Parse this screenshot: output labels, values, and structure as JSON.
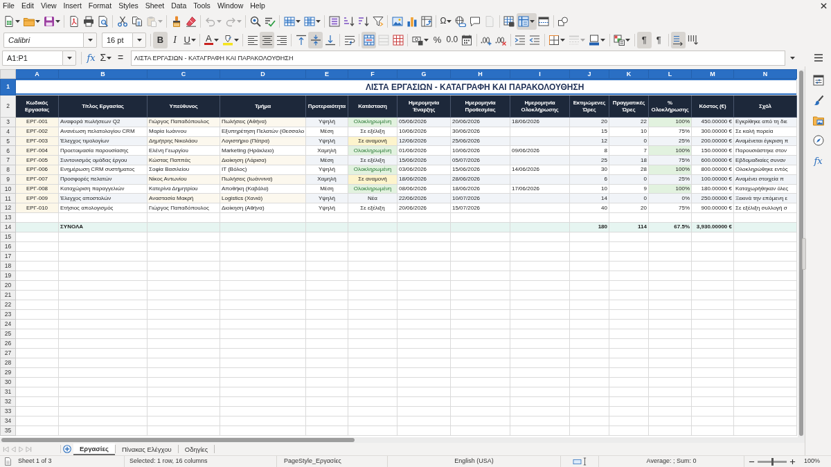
{
  "menu": [
    "File",
    "Edit",
    "View",
    "Insert",
    "Format",
    "Styles",
    "Sheet",
    "Data",
    "Tools",
    "Window",
    "Help"
  ],
  "standard_toolbar": [
    {
      "pressed": false,
      "disabled": false
    },
    {
      "pressed": false,
      "disabled": false
    },
    {
      "pressed": false,
      "disabled": false
    },
    {
      "pressed": false,
      "disabled": false
    },
    {
      "pressed": false,
      "disabled": false
    },
    {
      "pressed": false,
      "disabled": false
    },
    {
      "pressed": false,
      "disabled": false
    },
    {
      "pressed": false,
      "disabled": false
    },
    {
      "pressed": false,
      "disabled": true
    },
    {
      "pressed": false,
      "disabled": false
    },
    {
      "pressed": false,
      "disabled": false
    },
    {
      "pressed": false,
      "disabled": true
    },
    {
      "pressed": false,
      "disabled": true
    },
    {
      "pressed": false,
      "disabled": false
    },
    {
      "pressed": false,
      "disabled": false
    },
    {
      "pressed": false,
      "disabled": false
    },
    {
      "pressed": false,
      "disabled": false
    },
    {
      "pressed": false,
      "disabled": false
    },
    {
      "pressed": false,
      "disabled": false
    },
    {
      "pressed": false,
      "disabled": false
    },
    {
      "pressed": false,
      "disabled": false
    },
    {
      "pressed": false,
      "disabled": false
    },
    {
      "pressed": false,
      "disabled": false
    },
    {
      "pressed": false,
      "disabled": false
    },
    {
      "label": "Ω",
      "pressed": false,
      "disabled": false
    },
    {
      "pressed": false,
      "disabled": false
    },
    {
      "pressed": false,
      "disabled": false
    },
    {
      "pressed": false,
      "disabled": true
    },
    {
      "pressed": false,
      "disabled": false
    },
    {
      "pressed": true,
      "disabled": false
    },
    {
      "pressed": false,
      "disabled": false
    },
    {
      "pressed": false,
      "disabled": false
    }
  ],
  "formatting_toolbar": {
    "font_name": "Calibri",
    "font_size": "16 pt",
    "buttons": [
      {
        "label": "B",
        "pressed": true,
        "disabled": false
      },
      {
        "label": "I",
        "pressed": false,
        "disabled": false
      },
      {
        "label": "U",
        "pressed": false,
        "disabled": false
      },
      {
        "label": "A",
        "pressed": false,
        "disabled": false
      },
      {
        "pressed": false,
        "disabled": false
      },
      {
        "pressed": false,
        "disabled": false
      },
      {
        "pressed": true,
        "disabled": false
      },
      {
        "pressed": false,
        "disabled": false
      },
      {
        "pressed": false,
        "disabled": false
      },
      {
        "pressed": true,
        "disabled": false
      },
      {
        "pressed": false,
        "disabled": false
      },
      {
        "pressed": false,
        "disabled": false
      },
      {
        "pressed": true,
        "disabled": false
      },
      {
        "pressed": false,
        "disabled": true
      },
      {
        "pressed": false,
        "disabled": false
      },
      {
        "pressed": false,
        "disabled": false
      },
      {
        "label": "%",
        "pressed": false,
        "disabled": false
      },
      {
        "label": "0.0",
        "pressed": false,
        "disabled": false
      },
      {
        "pressed": false,
        "disabled": false
      },
      {
        "pressed": false,
        "disabled": false
      },
      {
        "pressed": false,
        "disabled": false
      },
      {
        "pressed": false,
        "disabled": false
      },
      {
        "pressed": false,
        "disabled": false
      },
      {
        "pressed": false,
        "disabled": false
      },
      {
        "pressed": false,
        "disabled": true
      },
      {
        "pressed": false,
        "disabled": false
      },
      {
        "pressed": false,
        "disabled": false
      },
      {
        "label": "¶",
        "pressed": true,
        "disabled": false
      },
      {
        "label": "¶",
        "pressed": false,
        "disabled": false
      },
      {
        "pressed": true,
        "disabled": false
      },
      {
        "pressed": false,
        "disabled": false
      }
    ]
  },
  "formula_bar": {
    "name_box": "A1:P1",
    "function_wizard": "fx",
    "sum": "Σ",
    "equals": "=",
    "content": "ΛΙΣΤΑ ΕΡΓΑΣΙΩΝ - ΚΑΤΑΓΡΑΦΗ ΚΑΙ ΠΑΡΑΚΟΛΟΥΘΗΣΗ"
  },
  "sheet": {
    "columns": [
      {
        "letter": "A",
        "selected": true
      },
      {
        "letter": "B",
        "selected": true
      },
      {
        "letter": "C",
        "selected": true
      },
      {
        "letter": "D",
        "selected": true
      },
      {
        "letter": "E",
        "selected": true
      },
      {
        "letter": "F",
        "selected": true
      },
      {
        "letter": "G",
        "selected": true
      },
      {
        "letter": "H",
        "selected": true
      },
      {
        "letter": "I",
        "selected": true
      },
      {
        "letter": "J",
        "selected": true
      },
      {
        "letter": "K",
        "selected": true
      },
      {
        "letter": "L",
        "selected": true
      },
      {
        "letter": "M",
        "selected": true
      },
      {
        "letter": "N",
        "selected": true
      }
    ],
    "rows": [
      {
        "number": "1",
        "kind": "title",
        "selected": true,
        "text": "ΛΙΣΤΑ ΕΡΓΑΣΙΩΝ - ΚΑΤΑΓΡΑΦΗ ΚΑΙ ΠΑΡΑΚΟΛΟΥΘΗΣΗ"
      },
      {
        "number": "2",
        "kind": "header",
        "selected": false,
        "cells": {
          "A": "Κωδικός Εργασίας",
          "B": "Τίτλος Εργασίας",
          "C": "Υπεύθυνος",
          "D": "Τμήμα",
          "E": "Προτεραιότητα",
          "F": "Κατάσταση",
          "G": "Ημερομηνία Έναρξης",
          "H": "Ημερομηνία Προθεσμίας",
          "I": "Ημερομηνία Ολοκλήρωσης",
          "J": "Εκτιμώμενες Ώρες",
          "K": "Πραγματικές Ώρες",
          "L": "% Ολοκλήρωσης",
          "M": "Κόστος (€)",
          "N": "Σχόλ"
        }
      },
      {
        "number": "3",
        "kind": "data",
        "selected": false,
        "complete": true,
        "waiting": false,
        "department_clipped": false,
        "cells": {
          "A": "ΕΡΓ-001",
          "B": "Αναφορά πωλήσεων Q2",
          "C": "Γιώργος Παπαδόπουλος",
          "D": "Πωλήσεις (Αθήνα)",
          "E": "Υψηλή",
          "F": "Ολοκληρωμένη",
          "G": "05/06/2026",
          "H": "20/06/2026",
          "I": "18/06/2026",
          "J": "20",
          "K": "22",
          "L": "100%",
          "M": "450.00000 €",
          "N": "Εγκρίθηκε από τη διε"
        }
      },
      {
        "number": "4",
        "kind": "data",
        "selected": false,
        "complete": false,
        "waiting": false,
        "department_clipped": true,
        "cells": {
          "A": "ΕΡΓ-002",
          "B": "Ανανέωση πελατολογίου CRM",
          "C": "Μαρία Ιωάννου",
          "D": "Εξυπηρέτηση Πελατών (Θεσσαλο",
          "E": "Μέση",
          "F": "Σε εξέλιξη",
          "G": "10/06/2026",
          "H": "30/06/2026",
          "J": "15",
          "K": "10",
          "L": "75%",
          "M": "300.00000 €",
          "N": "Σε καλή πορεία"
        }
      },
      {
        "number": "5",
        "kind": "data",
        "selected": false,
        "complete": false,
        "waiting": true,
        "department_clipped": false,
        "cells": {
          "A": "ΕΡΓ-003",
          "B": "Έλεγχος τιμολογίων",
          "C": "Δημήτρης Νικολάου",
          "D": "Λογιστήριο (Πάτρα)",
          "E": "Υψηλή",
          "F": "Σε αναμονή",
          "G": "12/06/2026",
          "H": "25/06/2026",
          "J": "12",
          "K": "0",
          "L": "25%",
          "M": "200.00000 €",
          "N": "Αναμένεται έγκριση π"
        }
      },
      {
        "number": "6",
        "kind": "data",
        "selected": false,
        "complete": true,
        "waiting": false,
        "department_clipped": false,
        "cells": {
          "A": "ΕΡΓ-004",
          "B": "Προετοιμασία παρουσίασης",
          "C": "Ελένη Γεωργίου",
          "D": "Marketing (Ηράκλειο)",
          "E": "Χαμηλή",
          "F": "Ολοκληρωμένη",
          "G": "01/06/2026",
          "H": "10/06/2026",
          "I": "09/06/2026",
          "J": "8",
          "K": "7",
          "L": "100%",
          "M": "150.00000 €",
          "N": "Παρουσιάστηκε στον"
        }
      },
      {
        "number": "7",
        "kind": "data",
        "selected": false,
        "complete": false,
        "waiting": false,
        "department_clipped": false,
        "cells": {
          "A": "ΕΡΓ-005",
          "B": "Συντονισμός ομάδας έργου",
          "C": "Κώστας Παππάς",
          "D": "Διοίκηση (Λάρισα)",
          "E": "Μέση",
          "F": "Σε εξέλιξη",
          "G": "15/06/2026",
          "H": "05/07/2026",
          "J": "25",
          "K": "18",
          "L": "75%",
          "M": "600.00000 €",
          "N": "Εβδομαδιαίες συναν"
        }
      },
      {
        "number": "8",
        "kind": "data",
        "selected": false,
        "complete": true,
        "waiting": false,
        "department_clipped": false,
        "cells": {
          "A": "ΕΡΓ-006",
          "B": "Ενημέρωση CRM συστήματος",
          "C": "Σοφία Βασιλείου",
          "D": "IT (Βόλος)",
          "E": "Υψηλή",
          "F": "Ολοκληρωμένη",
          "G": "03/06/2026",
          "H": "15/06/2026",
          "I": "14/06/2026",
          "J": "30",
          "K": "28",
          "L": "100%",
          "M": "800.00000 €",
          "N": "Ολοκληρώθηκε εντός"
        }
      },
      {
        "number": "9",
        "kind": "data",
        "selected": false,
        "complete": false,
        "waiting": true,
        "department_clipped": false,
        "cells": {
          "A": "ΕΡΓ-007",
          "B": "Προσφορές πελατών",
          "C": "Νίκος Αντωνίου",
          "D": "Πωλήσεις (Ιωάννινα)",
          "E": "Χαμηλή",
          "F": "Σε αναμονή",
          "G": "18/06/2026",
          "H": "28/06/2026",
          "J": "6",
          "K": "0",
          "L": "25%",
          "M": "100.00000 €",
          "N": "Αναμένει στοιχεία π"
        }
      },
      {
        "number": "10",
        "kind": "data",
        "selected": false,
        "complete": true,
        "waiting": false,
        "department_clipped": false,
        "cells": {
          "A": "ΕΡΓ-008",
          "B": "Καταχώριση παραγγελιών",
          "C": "Κατερίνα Δημητρίου",
          "D": "Αποθήκη (Καβάλα)",
          "E": "Μέση",
          "F": "Ολοκληρωμένη",
          "G": "08/06/2026",
          "H": "18/06/2026",
          "I": "17/06/2026",
          "J": "10",
          "K": "9",
          "L": "100%",
          "M": "180.00000 €",
          "N": "Καταχωρήθηκαν όλες"
        }
      },
      {
        "number": "11",
        "kind": "data",
        "selected": false,
        "complete": false,
        "waiting": false,
        "department_clipped": false,
        "cells": {
          "A": "ΕΡΓ-009",
          "B": "Έλεγχος αποστολών",
          "C": "Αναστασία Μακρή",
          "D": "Logistics (Χανιά)",
          "E": "Υψηλή",
          "F": "Νέα",
          "G": "22/06/2026",
          "H": "10/07/2026",
          "J": "14",
          "K": "0",
          "L": "0%",
          "M": "250.00000 €",
          "N": "Ξεκινά την επόμενη ε"
        }
      },
      {
        "number": "12",
        "kind": "data",
        "selected": false,
        "complete": false,
        "waiting": false,
        "department_clipped": false,
        "cells": {
          "A": "ΕΡΓ-010",
          "B": "Ετήσιος απολογισμός",
          "C": "Γιώργος Παπαδόπουλος",
          "D": "Διοίκηση (Αθήνα)",
          "E": "Υψηλή",
          "F": "Σε εξέλιξη",
          "G": "20/06/2026",
          "H": "15/07/2026",
          "J": "40",
          "K": "20",
          "L": "75%",
          "M": "900.00000 €",
          "N": "Σε εξέλιξη συλλογή σ"
        }
      },
      {
        "number": "13",
        "kind": "empty",
        "selected": false
      },
      {
        "number": "14",
        "kind": "total",
        "selected": false,
        "cells": {
          "B": "ΣΥΝΟΛΑ",
          "J": "180",
          "K": "114",
          "L": "67.5%",
          "M": "3,930.00000 €"
        }
      },
      {
        "number": "15",
        "kind": "empty",
        "selected": false
      },
      {
        "number": "16",
        "kind": "empty",
        "selected": false
      },
      {
        "number": "17",
        "kind": "empty",
        "selected": false
      },
      {
        "number": "18",
        "kind": "empty",
        "selected": false
      },
      {
        "number": "19",
        "kind": "empty",
        "selected": false
      },
      {
        "number": "20",
        "kind": "empty",
        "selected": false
      },
      {
        "number": "21",
        "kind": "empty",
        "selected": false
      },
      {
        "number": "22",
        "kind": "empty",
        "selected": false
      },
      {
        "number": "23",
        "kind": "empty",
        "selected": false
      },
      {
        "number": "24",
        "kind": "empty",
        "selected": false
      },
      {
        "number": "25",
        "kind": "empty",
        "selected": false
      },
      {
        "number": "26",
        "kind": "empty",
        "selected": false
      },
      {
        "number": "27",
        "kind": "empty",
        "selected": false
      },
      {
        "number": "28",
        "kind": "empty",
        "selected": false
      },
      {
        "number": "29",
        "kind": "empty",
        "selected": false
      },
      {
        "number": "30",
        "kind": "empty",
        "selected": false
      },
      {
        "number": "31",
        "kind": "empty",
        "selected": false
      },
      {
        "number": "32",
        "kind": "empty",
        "selected": false
      },
      {
        "number": "33",
        "kind": "empty",
        "selected": false
      },
      {
        "number": "34",
        "kind": "empty",
        "selected": false
      },
      {
        "number": "35",
        "kind": "empty",
        "selected": false
      }
    ]
  },
  "sheet_navigation": [
    {
      "disabled": true
    },
    {
      "disabled": true
    },
    {
      "disabled": true
    },
    {
      "disabled": true
    }
  ],
  "sheet_tabs": [
    {
      "label": "Εργασίες",
      "selected": true
    },
    {
      "label": "Πίνακας Ελέγχου",
      "selected": false
    },
    {
      "label": "Οδηγίες",
      "selected": false
    }
  ],
  "sidebar": {
    "functions_label": "fx"
  },
  "status_bar": {
    "sheet": "Sheet 1 of 3",
    "selection": "Selected: 1 row, 16 columns",
    "page_style": "PageStyle_Εργασίες",
    "language": "English (USA)",
    "statistics": "Average: ; Sum: 0",
    "zoom": {
      "level": 0.5,
      "reading": "100%"
    }
  }
}
